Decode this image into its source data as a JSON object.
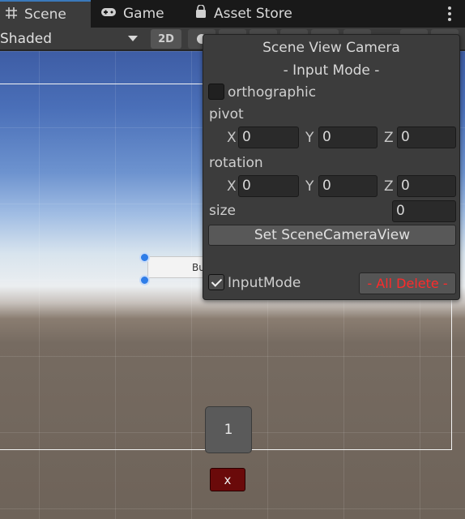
{
  "tabs": [
    {
      "label": "Scene",
      "icon": "grid-icon"
    },
    {
      "label": "Game",
      "icon": "gamepad-icon"
    },
    {
      "label": "Asset Store",
      "icon": "shopping-bag-icon"
    }
  ],
  "toolbar": {
    "shading_mode": "Shaded",
    "toggle_2d": "2D"
  },
  "scene": {
    "ui_button_label": "Bu",
    "number_button_label": "1",
    "x_button_label": "x"
  },
  "panel": {
    "title": "Scene View Camera",
    "subtitle": "- Input Mode -",
    "orthographic_label": "orthographic",
    "orthographic_checked": false,
    "pivot_label": "pivot",
    "pivot": {
      "x": "0",
      "y": "0",
      "z": "0"
    },
    "rotation_label": "rotation",
    "rotation": {
      "x": "0",
      "y": "0",
      "z": "0"
    },
    "axis_labels": {
      "x": "X",
      "y": "Y",
      "z": "Z"
    },
    "size_label": "size",
    "size_value": "0",
    "set_button": "Set SceneCameraView",
    "input_mode_label": "InputMode",
    "input_mode_checked": true,
    "delete_button": "- All Delete -"
  },
  "colors": {
    "accent": "#3a79bb",
    "delete_text": "#ff2a2a",
    "x_button": "#6a0a0a"
  }
}
